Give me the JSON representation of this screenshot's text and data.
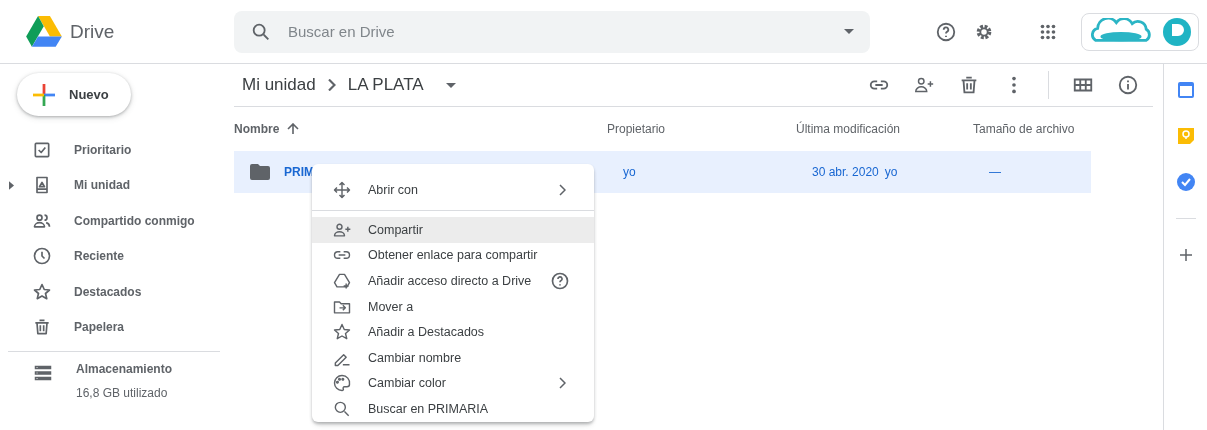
{
  "header": {
    "app_name": "Drive",
    "search": {
      "placeholder": "Buscar en Drive"
    }
  },
  "sidebar": {
    "new_button": "Nuevo",
    "items": [
      {
        "label": "Prioritario",
        "selected": false
      },
      {
        "label": "Mi unidad",
        "selected": false,
        "expanded": false
      },
      {
        "label": "Compartido conmigo",
        "selected": false
      },
      {
        "label": "Reciente",
        "selected": false
      },
      {
        "label": "Destacados",
        "selected": false
      },
      {
        "label": "Papelera",
        "selected": false
      }
    ],
    "storage": {
      "label": "Almacenamiento",
      "usage": "16,8 GB utilizado"
    }
  },
  "breadcrumb": [
    "Mi unidad",
    "LA PLATA"
  ],
  "table": {
    "columns": [
      "Nombre",
      "Propietario",
      "Última modificación",
      "Tamaño de archivo"
    ],
    "rows": [
      {
        "name": "PRIM",
        "owner": "yo",
        "modified": "30 abr. 2020",
        "modified_by": "yo",
        "size": "—",
        "selected": true
      }
    ]
  },
  "context_menu": [
    {
      "label": "Abrir con",
      "submenu": true,
      "help": false,
      "selected": false,
      "divider_after": true
    },
    {
      "label": "Compartir",
      "submenu": false,
      "help": false,
      "selected": true,
      "divider_after": false
    },
    {
      "label": "Obtener enlace para compartir",
      "submenu": false,
      "help": false,
      "selected": false,
      "divider_after": false
    },
    {
      "label": "Añadir acceso directo a Drive",
      "submenu": false,
      "help": true,
      "selected": false,
      "divider_after": false
    },
    {
      "label": "Mover a",
      "submenu": false,
      "help": false,
      "selected": false,
      "divider_after": false
    },
    {
      "label": "Añadir a Destacados",
      "submenu": false,
      "help": false,
      "selected": false,
      "divider_after": false
    },
    {
      "label": "Cambiar nombre",
      "submenu": false,
      "help": false,
      "selected": false,
      "divider_after": false
    },
    {
      "label": "Cambiar color",
      "submenu": true,
      "help": false,
      "selected": false,
      "divider_after": false
    },
    {
      "label": "Buscar en PRIMARIA",
      "submenu": false,
      "help": false,
      "selected": false,
      "divider_after": false
    }
  ]
}
